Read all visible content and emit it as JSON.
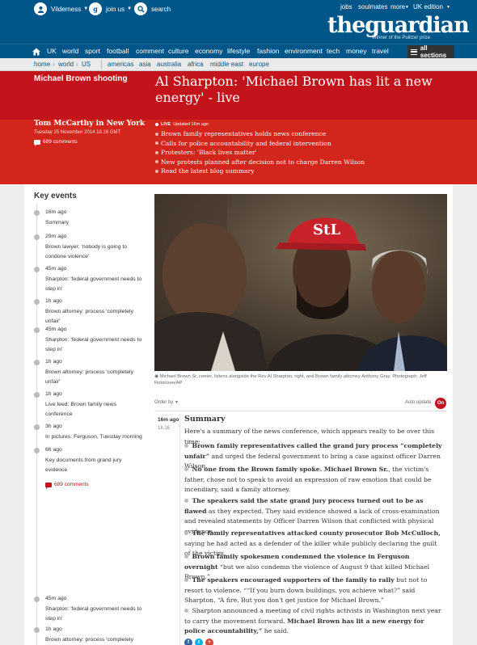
{
  "topbar": {
    "edition_user": "Vilderness",
    "join": "join us",
    "search": "search",
    "links": [
      "jobs",
      "soulmates",
      "more",
      "UK edition"
    ]
  },
  "logo": {
    "name": "theguardian",
    "tagline": "Winner of the Pulitzer prize"
  },
  "nav": {
    "items": [
      "UK",
      "world",
      "sport",
      "football",
      "comment",
      "culture",
      "economy",
      "lifestyle",
      "fashion",
      "environment",
      "tech",
      "money",
      "travel"
    ],
    "all_sections": "all sections"
  },
  "subnav": {
    "breadcrumb": [
      "home",
      "world",
      "US"
    ],
    "regions": [
      "americas",
      "asia",
      "australia",
      "africa",
      "middle east",
      "europe"
    ]
  },
  "article": {
    "series": "Michael Brown shooting",
    "headline": "Al Sharpton: 'Michael Brown has lit a new energy' - live",
    "byline": "Tom McCarthy in New York",
    "date": "Tuesday 25 November 2014 18.16 GMT",
    "comments": "689 comments",
    "live_label": "LIVE",
    "updated": "Updated 16m ago",
    "bullets": [
      "Brown family representatives holds news conference",
      "Calls for police accountability and federal intervention",
      "Protesters: 'Black lives matter'",
      "New protests planned after decision not to charge Darren Wilson",
      "Read the latest blog summary"
    ],
    "caption": "Michael Brown Sr, center, listens alongside the Rev Al Sharpton, right, and Brown family attorney Anthony Gray. Photograph: Jeff Roberson/AP"
  },
  "key_events": {
    "title": "Key events",
    "items": [
      {
        "time": "16m ago",
        "label": "Summary"
      },
      {
        "time": "29m ago",
        "label": "Brown lawyer: 'nobody is going to condone violence'"
      },
      {
        "time": "45m ago",
        "label": "Sharpton: 'federal government needs to step in'"
      },
      {
        "time": "1h ago",
        "label": "Brown attorney: process 'completely unfair'"
      },
      {
        "time": "45m ago",
        "label": "Sharpton: 'federal government needs to step in'"
      },
      {
        "time": "1h ago",
        "label": "Brown attorney: process 'completely unfair'"
      },
      {
        "time": "1h ago",
        "label": "Live feed: Brown family news conference"
      },
      {
        "time": "3h ago",
        "label": "In pictures: Ferguson, Tuesday morning"
      },
      {
        "time": "6h ago",
        "label": "Key documents from grand jury evidence"
      },
      {
        "time": "45m ago",
        "label": "Sharpton: 'federal government needs to step in'"
      },
      {
        "time": "1h ago",
        "label": "Brown attorney: process 'completely"
      }
    ],
    "comments": "689 comments"
  },
  "controls": {
    "order_by": "Order by",
    "auto_update": "Auto update:",
    "on": "On"
  },
  "post": {
    "time": "16m ago",
    "time2": "18.16",
    "title": "Summary",
    "intro": "Here's a summary of the news conference, which appears really to be over this time:",
    "paras": [
      {
        "bold": "Brown family representatives called the grand jury process “completely unfair”",
        "rest": " and urged the federal government to bring a case against officer Darren Wilson."
      },
      {
        "bold": "No one from the Brown family spoke. Michael Brown Sr.",
        "rest": ", the victim's father, chose not to speak to avoid an expression of raw emotion that could be incendiary, said a family attorney."
      },
      {
        "bold": "The speakers said the state grand jury process turned out to be as flawed",
        "rest": " as they expected. They said evidence showed a lack of cross-examination and revealed statements by Officer Darren Wilson that conflicted with physical evidence."
      },
      {
        "bold": "The family representatives attacked county prosecutor Bob McCulloch,",
        "rest": " saying he had acted as a defender of the killer while publicly declaring the guilt of the victim."
      },
      {
        "bold": "Brown family spokesmen condemned the violence in Ferguson overnight",
        "rest": " “but we also condemn the violence of August 9 that killed Michael Brown.”"
      },
      {
        "bold": "The speakers encouraged supporters of the family to rally",
        "rest": " but not to resort to violence. ““If you burn down buildings, you achieve what?” said Sharpton. “A fire. But you don't get justice for Michael Brown.”"
      },
      {
        "bold": "",
        "rest": "Sharpton announced a meeting of civil rights activists in Washington next year to carry the movement forward. ",
        "bold2": "Michael Brown has lit a new energy for police accountability,”",
        "rest2": " he said."
      }
    ]
  },
  "colors": {
    "brand_blue": "#005689",
    "live_red": "#c2141a",
    "header_red": "#d2261c"
  }
}
